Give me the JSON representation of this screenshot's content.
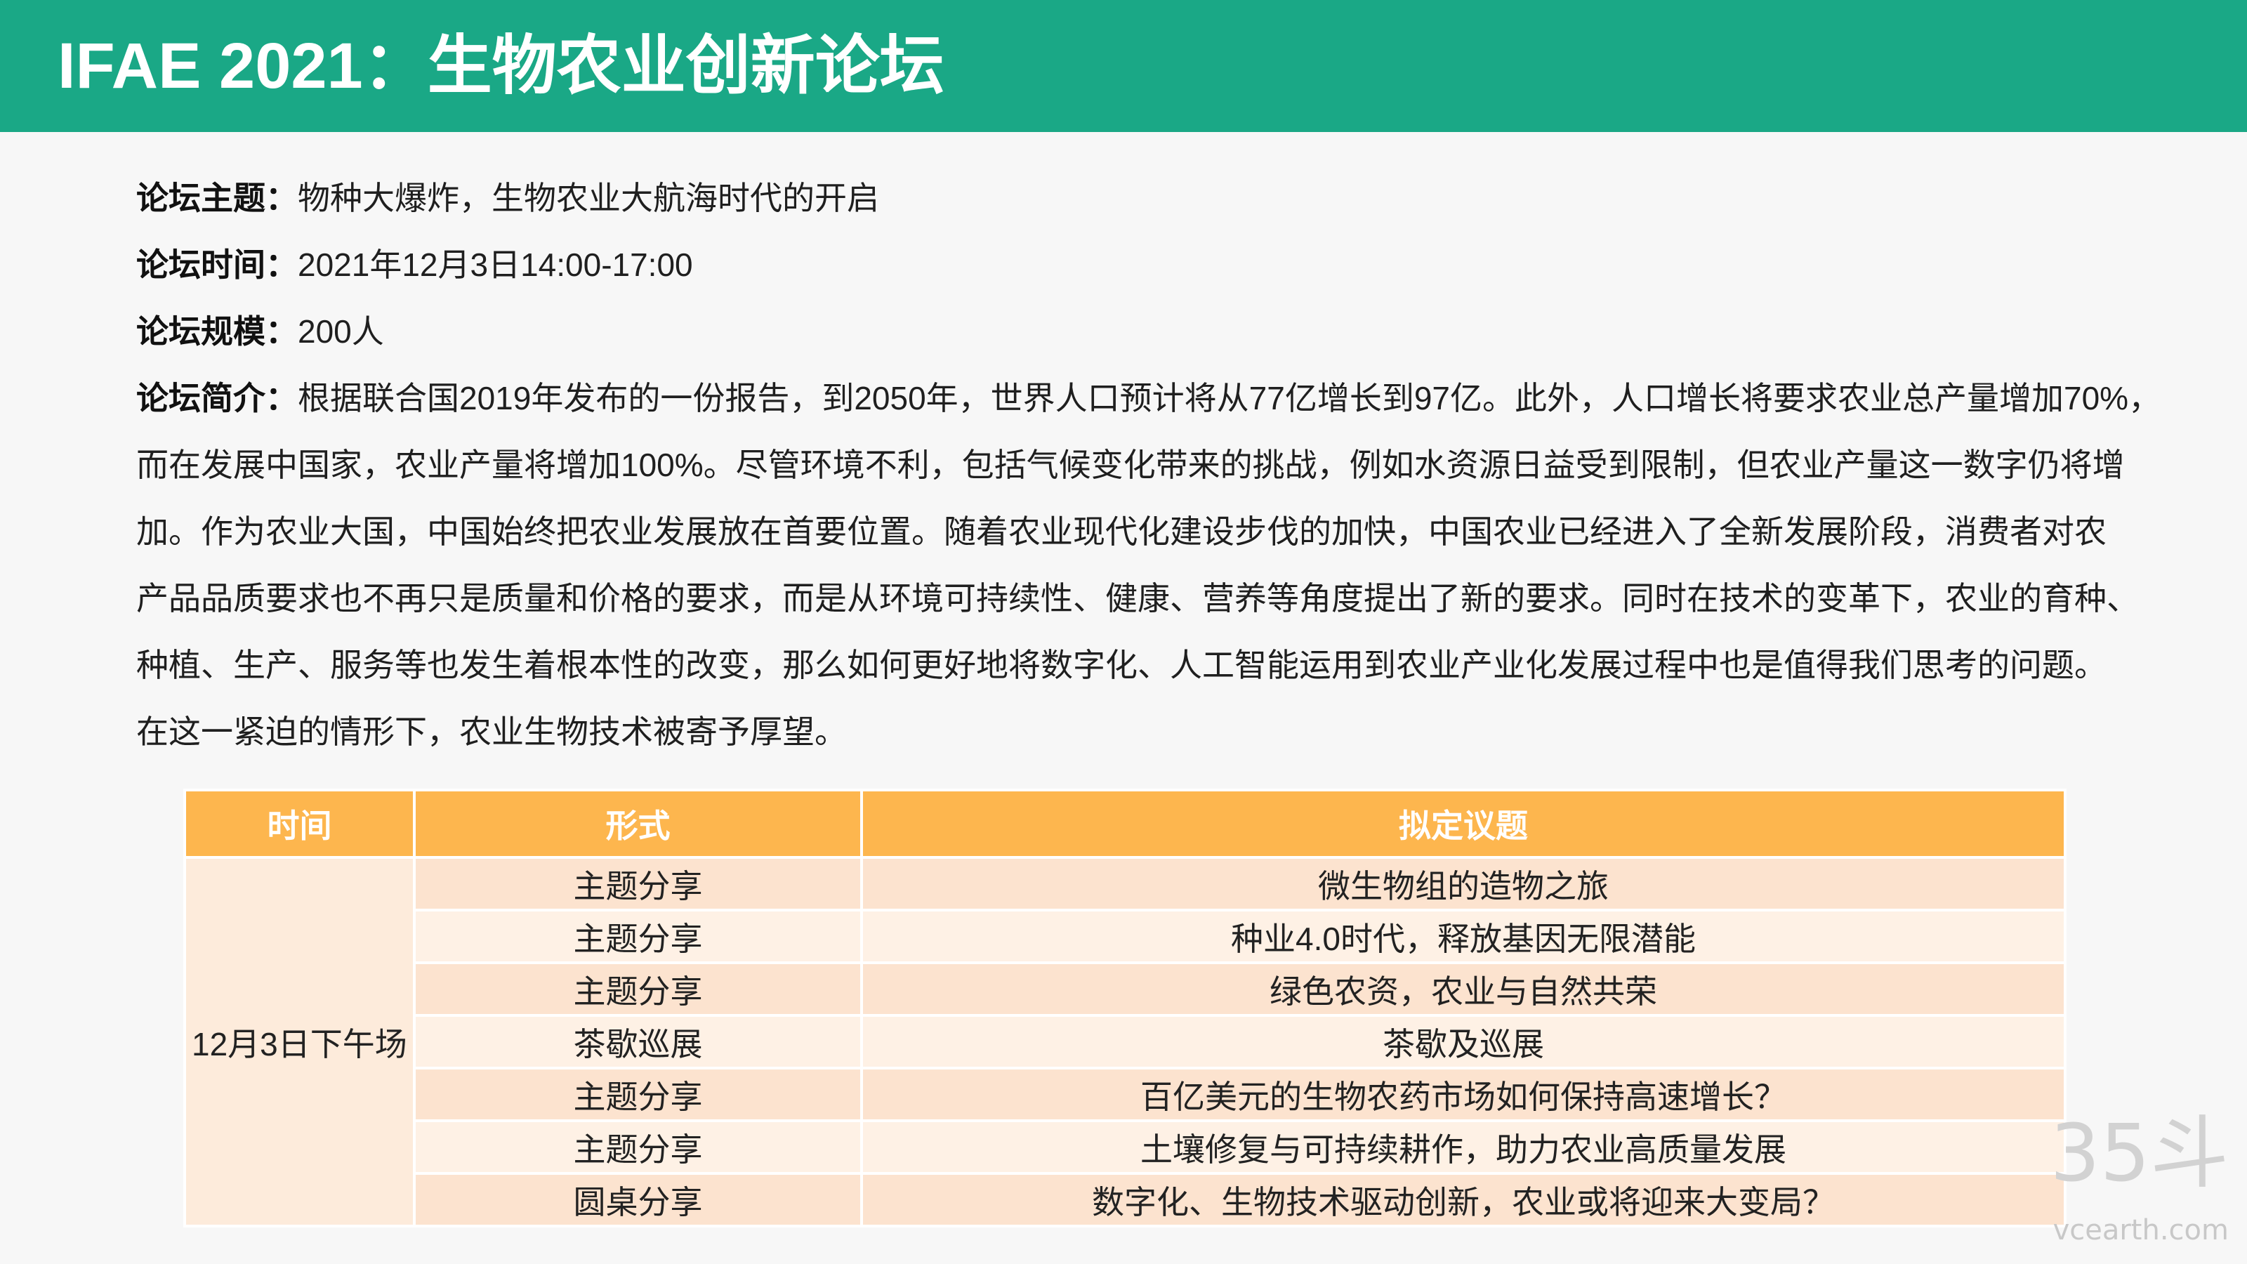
{
  "header": {
    "title": "IFAE 2021：生物农业创新论坛"
  },
  "info": {
    "theme": {
      "label": "论坛主题：",
      "value": "物种大爆炸，生物农业大航海时代的开启"
    },
    "time": {
      "label": "论坛时间：",
      "value": "2021年12月3日14:00-17:00"
    },
    "scale": {
      "label": "论坛规模：",
      "value": "200人"
    },
    "intro": {
      "label": "论坛简介：",
      "lines": [
        "根据联合国2019年发布的一份报告，到2050年，世界人口预计将从77亿增长到97亿。此外，人口增长将要求农业总产量增加70%，",
        "而在发展中国家，农业产量将增加100%。尽管环境不利，包括气候变化带来的挑战，例如水资源日益受到限制，但农业产量这一数字仍将增",
        "加。作为农业大国，中国始终把农业发展放在首要位置。随着农业现代化建设步伐的加快，中国农业已经进入了全新发展阶段，消费者对农",
        "产品品质要求也不再只是质量和价格的要求，而是从环境可持续性、健康、营养等角度提出了新的要求。同时在技术的变革下，农业的育种、",
        "种植、生产、服务等也发生着根本性的改变，那么如何更好地将数字化、人工智能运用到农业产业化发展过程中也是值得我们思考的问题。",
        "在这一紧迫的情形下，农业生物技术被寄予厚望。"
      ]
    }
  },
  "agenda": {
    "columns": [
      "时间",
      "形式",
      "拟定议题"
    ],
    "session": "12月3日下午场",
    "rows": [
      {
        "format": "主题分享",
        "topic": "微生物组的造物之旅"
      },
      {
        "format": "主题分享",
        "topic": "种业4.0时代，释放基因无限潜能"
      },
      {
        "format": "主题分享",
        "topic": "绿色农资，农业与自然共荣"
      },
      {
        "format": "茶歇巡展",
        "topic": "茶歇及巡展"
      },
      {
        "format": "主题分享",
        "topic": "百亿美元的生物农药市场如何保持高速增长？"
      },
      {
        "format": "主题分享",
        "topic": "土壤修复与可持续耕作，助力农业高质量发展"
      },
      {
        "format": "圆桌分享",
        "topic": "数字化、生物技术驱动创新，农业或将迎来大变局？"
      }
    ]
  },
  "watermark": {
    "logo": "35斗",
    "site": "vcearth.com"
  },
  "colors": {
    "title_bar": "#1aa886",
    "table_header": "#fdb64e",
    "row_dark": "#fce3cf",
    "row_light": "#fef1e5",
    "session_cell": "#fdebdb"
  }
}
